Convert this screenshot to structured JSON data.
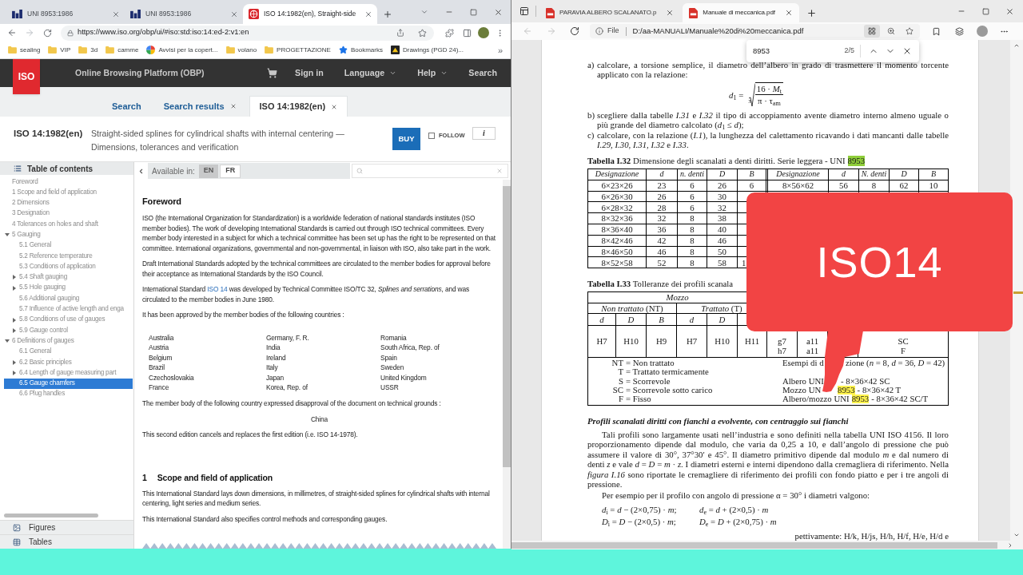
{
  "left_window": {
    "tabs": [
      {
        "title": "UNI 8953:1986",
        "kind": "uni",
        "selected": false
      },
      {
        "title": "UNI 8953:1986",
        "kind": "uni",
        "selected": false
      },
      {
        "title": "ISO 14:1982(en), Straight-side",
        "kind": "iso",
        "selected": true
      }
    ],
    "url": "https://www.iso.org/obp/ui/#iso:std:iso:14:ed-2:v1:en",
    "bookmarks": [
      {
        "label": "sealing",
        "kind": "folder"
      },
      {
        "label": "VIP",
        "kind": "folder"
      },
      {
        "label": "3d",
        "kind": "folder"
      },
      {
        "label": "camme",
        "kind": "folder"
      },
      {
        "label": "Avvisi per la copert...",
        "kind": "site"
      },
      {
        "label": "volano",
        "kind": "folder"
      },
      {
        "label": "PROGETTAZIONE",
        "kind": "folder"
      },
      {
        "label": "Bookmarks",
        "kind": "star"
      },
      {
        "label": "Drawings (PGD 24)...",
        "kind": "app"
      }
    ],
    "bookmarks_more": "»",
    "site": {
      "logo": "ISO",
      "platform": "Online Browsing Platform (OBP)",
      "nav": [
        {
          "label": "Sign in",
          "dropdown": false
        },
        {
          "label": "Language",
          "dropdown": true
        },
        {
          "label": "Help",
          "dropdown": true
        },
        {
          "label": "Search",
          "dropdown": false
        }
      ],
      "tabs": [
        {
          "label": "Search",
          "closable": false,
          "selected": false
        },
        {
          "label": "Search results",
          "closable": true,
          "selected": false
        },
        {
          "label": "ISO 14:1982(en)",
          "closable": true,
          "selected": true
        }
      ],
      "document": {
        "code": "ISO 14:1982(en)",
        "title": "Straight-sided splines for cylindrical shafts with internal centering — Dimensions, tolerances and verification",
        "buy": "BUY",
        "follow": {
          "label": "FOLLOW",
          "checked": false
        },
        "info": "i"
      },
      "toc": {
        "title": "Table of contents",
        "items": [
          {
            "label": "Foreword",
            "selected": false
          },
          {
            "label": "1 Scope and field of application",
            "selected": false
          },
          {
            "label": "2 Dimensions",
            "selected": false
          },
          {
            "label": "3 Designation",
            "selected": false
          },
          {
            "label": "4 Tolerances on holes and shaft",
            "selected": false
          },
          {
            "label": "5 Gauging",
            "selected": false,
            "expanded": true,
            "children": [
              {
                "label": "5.1 General",
                "selected": false
              },
              {
                "label": "5.2 Reference temperature",
                "selected": false
              },
              {
                "label": "5.3 Conditions of application",
                "selected": false
              },
              {
                "label": "5.4 Shaft gauging",
                "selected": false,
                "expanded": false
              },
              {
                "label": "5.5 Hole gauging",
                "selected": false,
                "expanded": false
              },
              {
                "label": "5.6 Additional gauging",
                "selected": false
              },
              {
                "label": "5.7 Influence of active length and enga",
                "selected": false
              },
              {
                "label": "5.8 Conditions of use of gauges",
                "selected": false,
                "expanded": false
              },
              {
                "label": "5.9 Gauge control",
                "selected": false,
                "expanded": false
              }
            ]
          },
          {
            "label": "6 Definitions of gauges",
            "selected": false,
            "expanded": true,
            "children": [
              {
                "label": "6.1 General",
                "selected": false
              },
              {
                "label": "6.2 Basic principles",
                "selected": false,
                "expanded": false
              },
              {
                "label": "6.4 Length of gauge measuring part",
                "selected": false,
                "expanded": false
              },
              {
                "label": "6.5 Gauge chamfers",
                "selected": true
              },
              {
                "label": "6.6 Plug handles",
                "selected": false
              }
            ]
          }
        ],
        "panels": [
          {
            "label": "Figures",
            "kind": "figures"
          },
          {
            "label": "Tables",
            "kind": "tables"
          }
        ]
      },
      "viewer": {
        "available": "Available in:",
        "languages": [
          {
            "label": "EN",
            "selected": true
          },
          {
            "label": "FR",
            "selected": false
          }
        ],
        "blocks": [
          {
            "kind": "heading",
            "text": "Foreword"
          },
          {
            "kind": "paragraph",
            "text": "ISO (the International Organization for Standardization) is a worldwide federation of national standards institutes (ISO member bodies). The work of developing International Standards is carried out through ISO technical committees. Every member body interested in a subject for which a technical committee has been set up has the right to be represented on that committee. International organizations, governmental and non-governmental, in liaison with ISO, also take part in the work."
          },
          {
            "kind": "paragraph",
            "text": "Draft International Standards adopted by the technical committees are circulated to the member bodies for approval before their acceptance as International Standards by the ISO Council."
          },
          {
            "kind": "paragraph",
            "text": "International Standard",
            "link": "ISO 14",
            "after": "was developed by Technical Committee ISO/TC 32, *Splines and serrations*, and was circulated to the member bodies in June 1980."
          },
          {
            "kind": "paragraph",
            "text": "It has been approved by the member bodies of the following countries :"
          },
          {
            "kind": "countries",
            "items": [
              "Australia",
              "Germany, F. R.",
              "Romania",
              "Austria",
              "India",
              "South Africa, Rep. of",
              "Belgium",
              "Ireland",
              "Spain",
              "Brazil",
              "Italy",
              "Sweden",
              "Czechoslovakia",
              "Japan",
              "United Kingdom",
              "France",
              "Korea, Rep. of",
              "USSR"
            ]
          },
          {
            "kind": "paragraph",
            "text": "The member body of the following country expressed disapproval of the document on technical grounds :"
          },
          {
            "kind": "centered",
            "text": "China"
          },
          {
            "kind": "paragraph",
            "text": "This second edition cancels and replaces the first edition (i.e. ISO 14-1978)."
          },
          {
            "kind": "section",
            "number": "1",
            "text": "Scope and field of application"
          },
          {
            "kind": "paragraph",
            "text": "This International Standard lays down dimensions, in millimetres, of straight-sided splines for cylindrical shafts with internal centering, light series and medium series."
          },
          {
            "kind": "paragraph",
            "text": "This International Standard also specifies control methods and corresponding gauges."
          }
        ]
      }
    }
  },
  "right_window": {
    "tabs": [
      {
        "title": "PARAVIA ALBERO SCALANATO.p",
        "selected": false
      },
      {
        "title": "Manuale di meccanica.pdf",
        "selected": true
      }
    ],
    "address": {
      "scheme": "File",
      "path": "D:/aa-MANUALI/Manuale%20di%20meccanica.pdf"
    },
    "find": {
      "query": "8953",
      "count": "2/5"
    },
    "callout": "ISO14",
    "pdf": {
      "blocks": [
        {
          "kind": "step",
          "label": "a)",
          "text": "calcolare, a torsione semplice, il diametro dell’albero in grado di trasmettere il momento torcente applicato con la relazione:"
        },
        {
          "kind": "formula",
          "lhs": "*d*$_{1}$ =",
          "index": "3",
          "numerator": "16 · *M*$_{t}$",
          "denominator": "π · τ$_{am}$"
        },
        {
          "kind": "step",
          "label": "b)",
          "text": "scegliere dalla tabelle *I.31* e *I.32* il tipo di accoppiamento avente diametro interno almeno uguale o più grande del diametro calcolato (*d*$_{1}$ ≤ *d*);"
        },
        {
          "kind": "step",
          "label": "c)",
          "text": "calcolare, con la relazione (*I.1*), la lunghezza del calettamento ricavando i dati mancanti dalle tabelle *I.29*, *I.30*, *I.31*, *I.32* e *I.33*."
        }
      ],
      "table_32": {
        "label": "Tabella I.32",
        "caption": "Dimensione degli scanalati a denti diritti. Serie leggera - UNI",
        "match": {
          "text": "8953",
          "current": true
        },
        "columns": [
          "Designazione",
          "d",
          "n. denti",
          "D",
          "B",
          "Designazione",
          "d",
          "N. denti",
          "D",
          "B"
        ],
        "rows": [
          [
            "6×23×26",
            "23",
            "6",
            "26",
            "6",
            "8×56×62",
            "56",
            "8",
            "62",
            "10"
          ],
          [
            "6×26×30",
            "26",
            "6",
            "30"
          ],
          [
            "6×28×32",
            "28",
            "6",
            "32"
          ],
          [
            "8×32×36",
            "32",
            "8",
            "38"
          ],
          [
            "8×36×40",
            "36",
            "8",
            "40"
          ],
          [
            "8×42×46",
            "42",
            "8",
            "46"
          ],
          [
            "8×46×50",
            "46",
            "8",
            "50"
          ],
          [
            "8×52×58",
            "52",
            "8",
            "58",
            {
              "text": "1",
              "kind": "clipped"
            }
          ]
        ]
      },
      "table_33": {
        "label": "Tabella I.33",
        "caption": "Tolleranze dei profili scanala",
        "group": "Mozzo",
        "subgroups": [
          "*Non trattato* (NT)",
          "*Trattato* (T)"
        ],
        "columns": [
          "d",
          "D",
          "B",
          "d",
          "D"
        ],
        "hole_fits": [
          "H7",
          "H10",
          "H9",
          "H7",
          "H10",
          "H11"
        ],
        "shaft_fits": [
          [
            "g7",
            "h7"
          ],
          [
            "a11",
            "a11"
          ]
        ],
        "modes": [
          "SC",
          "F"
        ],
        "legend": [
          {
            "abbr": "NT",
            "text": "= Non trattato"
          },
          {
            "abbr": "T",
            "text": "= Trattato termicamente"
          },
          {
            "abbr": "S",
            "text": "= Scorrevole"
          },
          {
            "abbr": "SC",
            "text": "= Scorrevole sotto carico"
          },
          {
            "abbr": "F",
            "text": "= Fisso"
          }
        ],
        "examples_title": [
          "Esempi di d",
          "zione (*n* = 8, *d* = 36, *D* = 42)"
        ],
        "examples": [
          [
            {
              "kind": "text",
              "text": "Albero UNI"
            },
            {
              "kind": "text",
              "text": "- 8×36×42 SC"
            }
          ],
          [
            {
              "kind": "text",
              "text": "Mozzo UN"
            },
            {
              "kind": "match",
              "text": "8953",
              "current": false
            },
            {
              "kind": "text",
              "text": "- 8×36×42 T"
            }
          ],
          [
            {
              "kind": "text",
              "text": "Albero/mozzo UNI"
            },
            {
              "kind": "match",
              "text": "8953",
              "current": false
            },
            {
              "kind": "text",
              "text": "- 8×36×42 SC/T"
            }
          ]
        ]
      },
      "section": {
        "title": "Profili scanalati diritti con fianchi a evolvente, con centraggio sui fianchi",
        "paragraphs": [
          "Tali profili sono largamente usati nell’industria e sono definiti nella tabella UNI ISO 4156. Il loro proporzionamento dipende dal modulo, che varia da 0,25 a 10, e dall’angolo di pressione che può assumere il valore di 30°, 37°30′ e 45°. Il diametro primitivo dipende dal modulo *m* e dal numero di denti *z* e vale *d* = *D* = *m* · *z*. I diametri esterni e interni dipendono dalla cremagliera di riferimento. Nella *figura I.16* sono riportate le cremagliere di riferimento dei profili con fondo piatto e per i tre angoli di pressione.",
          "Per esempio per il profilo con angolo di pressione α = 30° i diametri valgono:"
        ],
        "formulas": [
          [
            "*d*$_{i}$ = *d* − (2×0,75) · *m*;",
            "*d*$_{e}$ = *d* + (2×0,5) · *m*"
          ],
          [
            "*D*$_{i}$ = *D* − (2×0,5) · *m*;",
            "*D*$_{e}$ = *D* + (2×0,75) · *m*"
          ]
        ],
        "partial_line": "pettivamente: H/k, H/js, H/h, H/f, H/e, H/d e"
      }
    }
  }
}
